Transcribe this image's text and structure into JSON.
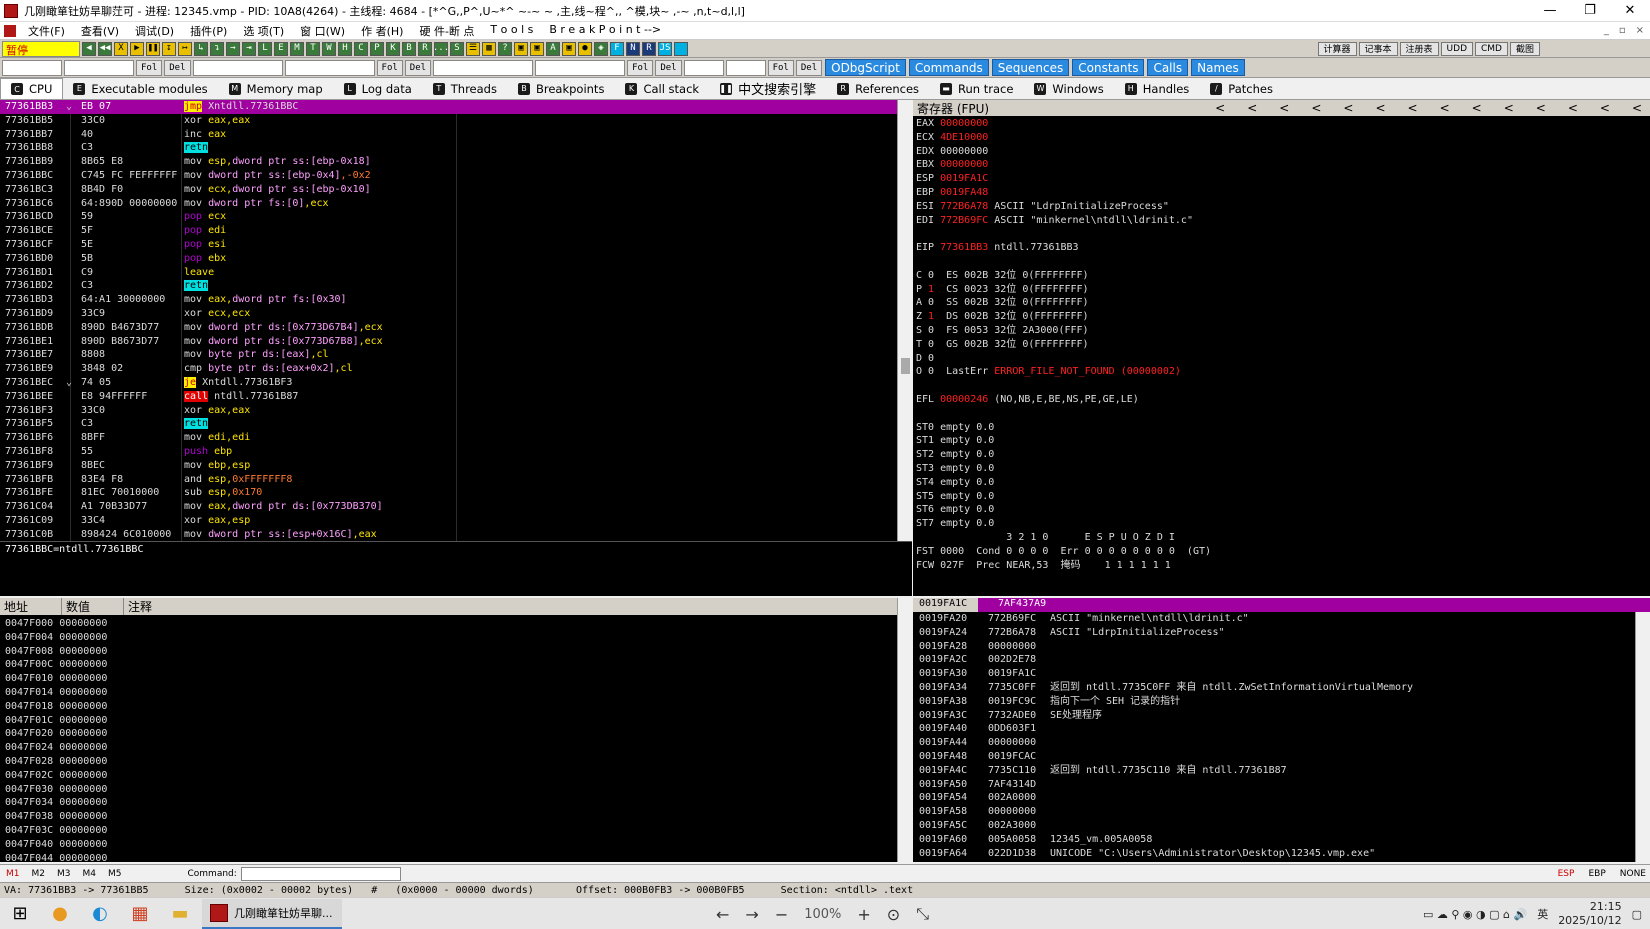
{
  "title": "几刚瞰箪钍妨旱聊茳可 - 进程: 12345.vmp - PID: 10A8(4264) - 主线程: 4684 - [*^G,,P^,U~*^ ~-~ ~ ,主,线~程^,, ^模,块~ ,-~ ,n,t~d,l,l]",
  "window_controls": [
    "—",
    "❐",
    "✕"
  ],
  "menu": [
    "文件(F)",
    "查看(V)",
    "调试(D)",
    "插件(P)",
    "选 项(T)",
    "窗 口(W)",
    "作 者(H)",
    "硬 件-断 点",
    "T o o l s",
    "B r e a k P o i n t -->"
  ],
  "menu_right": [
    "_",
    "▫",
    "×"
  ],
  "status_pause": "暂停",
  "toolbar_icons": [
    {
      "g": "◀",
      "k": "g"
    },
    {
      "g": "◀◀",
      "k": "g"
    },
    {
      "g": "X",
      "k": "y"
    },
    {
      "g": "▶",
      "k": "y"
    },
    {
      "g": "❚❚",
      "k": "y"
    },
    {
      "g": "↧",
      "k": "y"
    },
    {
      "g": "↦",
      "k": "y"
    },
    {
      "g": "↳",
      "k": "g"
    },
    {
      "g": "↴",
      "k": "g"
    },
    {
      "g": "→",
      "k": "g"
    },
    {
      "g": "⇥",
      "k": "g"
    },
    {
      "g": "L",
      "k": "g"
    },
    {
      "g": "E",
      "k": "g"
    },
    {
      "g": "M",
      "k": "g"
    },
    {
      "g": "T",
      "k": "g"
    },
    {
      "g": "W",
      "k": "g"
    },
    {
      "g": "H",
      "k": "g"
    },
    {
      "g": "C",
      "k": "g"
    },
    {
      "g": "P",
      "k": "g"
    },
    {
      "g": "K",
      "k": "g"
    },
    {
      "g": "B",
      "k": "g"
    },
    {
      "g": "R",
      "k": "g"
    },
    {
      "g": "...",
      "k": "g"
    },
    {
      "g": "S",
      "k": "g"
    },
    {
      "g": "☰",
      "k": "y"
    },
    {
      "g": "▦",
      "k": "y"
    },
    {
      "g": "?",
      "k": "g"
    },
    {
      "g": "▣",
      "k": "y"
    },
    {
      "g": "▣",
      "k": "y"
    },
    {
      "g": "A",
      "k": "g"
    },
    {
      "g": "▣",
      "k": "y"
    },
    {
      "g": "●",
      "k": "y"
    },
    {
      "g": "◈",
      "k": "g"
    },
    {
      "g": "F",
      "k": "c"
    },
    {
      "g": "N",
      "k": "b"
    },
    {
      "g": "R",
      "k": "b"
    },
    {
      "g": "JS",
      "k": "c"
    },
    {
      "g": " ",
      "k": "c"
    }
  ],
  "toolbar_tools": [
    "计算器",
    "记事本",
    "注册表",
    "UDD",
    "CMD",
    "截图"
  ],
  "fol_del_groups": [
    [
      "Fol",
      "Del"
    ],
    [
      "Fol",
      "Del"
    ],
    [
      "Fol",
      "Del"
    ],
    [
      "Fol",
      "Del"
    ]
  ],
  "plugin_buttons": [
    "ODbgScript",
    "Commands",
    "Sequences",
    "Constants",
    "Calls",
    "Names"
  ],
  "tabs": [
    {
      "label": "CPU",
      "icon": "C",
      "active": true
    },
    {
      "label": "Executable modules",
      "icon": "E"
    },
    {
      "label": "Memory map",
      "icon": "M"
    },
    {
      "label": "Log data",
      "icon": "L"
    },
    {
      "label": "Threads",
      "icon": "T"
    },
    {
      "label": "Breakpoints",
      "icon": "B"
    },
    {
      "label": "Call stack",
      "icon": "K"
    },
    {
      "label": "中文搜索引擎",
      "icon": "❚❚",
      "cn": true
    },
    {
      "label": "References",
      "icon": "R"
    },
    {
      "label": "Run trace",
      "icon": "▬"
    },
    {
      "label": "Windows",
      "icon": "W"
    },
    {
      "label": "Handles",
      "icon": "H"
    },
    {
      "label": "Patches",
      "icon": "/"
    }
  ],
  "disasm": [
    {
      "addr": "77361BB3",
      "mark": "⌄",
      "hex": "EB 07",
      "asm": [
        {
          "t": "jmp",
          "c": "kw-jmp"
        },
        {
          "t": " Xntdll.77361BBC"
        }
      ],
      "sel": true
    },
    {
      "addr": "77361BB5",
      "hex": "33C0",
      "asm": [
        {
          "t": "xor "
        },
        {
          "t": "eax,eax",
          "c": "arg-reg"
        }
      ]
    },
    {
      "addr": "77361BB7",
      "hex": "40",
      "asm": [
        {
          "t": "inc "
        },
        {
          "t": "eax",
          "c": "arg-reg"
        }
      ]
    },
    {
      "addr": "77361BB8",
      "hex": "C3",
      "asm": [
        {
          "t": "retn",
          "c": "kw-ret"
        }
      ]
    },
    {
      "addr": "77361BB9",
      "hex": "8B65 E8",
      "asm": [
        {
          "t": "mov "
        },
        {
          "t": "esp,",
          "c": "arg-reg"
        },
        {
          "t": "dword ptr ss:[ebp-0x18]",
          "c": "arg-mem"
        }
      ]
    },
    {
      "addr": "77361BBC",
      "hex": "C745 FC FEFFFFFF",
      "asm": [
        {
          "t": "mov "
        },
        {
          "t": "dword ptr ss:[ebp-0x4]",
          "c": "arg-mem"
        },
        {
          "t": ",-0x2",
          "c": "arg-num"
        }
      ]
    },
    {
      "addr": "77361BC3",
      "hex": "8B4D F0",
      "asm": [
        {
          "t": "mov "
        },
        {
          "t": "ecx,",
          "c": "arg-reg"
        },
        {
          "t": "dword ptr ss:[ebp-0x10]",
          "c": "arg-mem"
        }
      ]
    },
    {
      "addr": "77361BC6",
      "hex": "64:890D 00000000",
      "asm": [
        {
          "t": "mov "
        },
        {
          "t": "dword ptr fs:[0]",
          "c": "arg-mem"
        },
        {
          "t": ",ecx",
          "c": "arg-reg"
        }
      ]
    },
    {
      "addr": "77361BCD",
      "hex": "59",
      "asm": [
        {
          "t": "pop",
          "c": "kw-pop"
        },
        {
          "t": " ecx",
          "c": "arg-reg"
        }
      ]
    },
    {
      "addr": "77361BCE",
      "hex": "5F",
      "asm": [
        {
          "t": "pop",
          "c": "kw-pop"
        },
        {
          "t": " edi",
          "c": "arg-reg"
        }
      ]
    },
    {
      "addr": "77361BCF",
      "hex": "5E",
      "asm": [
        {
          "t": "pop",
          "c": "kw-pop"
        },
        {
          "t": " esi",
          "c": "arg-reg"
        }
      ]
    },
    {
      "addr": "77361BD0",
      "hex": "5B",
      "asm": [
        {
          "t": "pop",
          "c": "kw-pop"
        },
        {
          "t": " ebx",
          "c": "arg-reg"
        }
      ]
    },
    {
      "addr": "77361BD1",
      "hex": "C9",
      "asm": [
        {
          "t": "leave",
          "c": "arg-reg"
        }
      ]
    },
    {
      "addr": "77361BD2",
      "hex": "C3",
      "asm": [
        {
          "t": "retn",
          "c": "kw-ret"
        }
      ]
    },
    {
      "addr": "77361BD3",
      "hex": "64:A1 30000000",
      "asm": [
        {
          "t": "mov "
        },
        {
          "t": "eax,",
          "c": "arg-reg"
        },
        {
          "t": "dword ptr fs:[0x30]",
          "c": "arg-mem"
        }
      ]
    },
    {
      "addr": "77361BD9",
      "hex": "33C9",
      "asm": [
        {
          "t": "xor "
        },
        {
          "t": "ecx,ecx",
          "c": "arg-reg"
        }
      ]
    },
    {
      "addr": "77361BDB",
      "hex": "890D B4673D77",
      "asm": [
        {
          "t": "mov "
        },
        {
          "t": "dword ptr ds:[0x773D67B4]",
          "c": "arg-mem"
        },
        {
          "t": ",ecx",
          "c": "arg-reg"
        }
      ]
    },
    {
      "addr": "77361BE1",
      "hex": "890D B8673D77",
      "asm": [
        {
          "t": "mov "
        },
        {
          "t": "dword ptr ds:[0x773D67B8]",
          "c": "arg-mem"
        },
        {
          "t": ",ecx",
          "c": "arg-reg"
        }
      ]
    },
    {
      "addr": "77361BE7",
      "hex": "8808",
      "asm": [
        {
          "t": "mov "
        },
        {
          "t": "byte ptr ds:[eax]",
          "c": "arg-mem"
        },
        {
          "t": ",cl",
          "c": "arg-reg"
        }
      ]
    },
    {
      "addr": "77361BE9",
      "hex": "3848 02",
      "asm": [
        {
          "t": "cmp "
        },
        {
          "t": "byte ptr ds:[eax+0x2]",
          "c": "arg-mem"
        },
        {
          "t": ",cl",
          "c": "arg-reg"
        }
      ]
    },
    {
      "addr": "77361BEC",
      "mark": "⌄",
      "hex": "74 05",
      "asm": [
        {
          "t": "je",
          "c": "kw-jmp"
        },
        {
          "t": " Xntdll.77361BF3"
        }
      ]
    },
    {
      "addr": "77361BEE",
      "hex": "E8 94FFFFFF",
      "asm": [
        {
          "t": "call",
          "c": "kw-call"
        },
        {
          "t": " ntdll.77361B87"
        }
      ]
    },
    {
      "addr": "77361BF3",
      "hex": "33C0",
      "asm": [
        {
          "t": "xor "
        },
        {
          "t": "eax,eax",
          "c": "arg-reg"
        }
      ]
    },
    {
      "addr": "77361BF5",
      "hex": "C3",
      "asm": [
        {
          "t": "retn",
          "c": "kw-ret"
        }
      ]
    },
    {
      "addr": "77361BF6",
      "hex": "8BFF",
      "asm": [
        {
          "t": "mov "
        },
        {
          "t": "edi,edi",
          "c": "arg-reg"
        }
      ]
    },
    {
      "addr": "77361BF8",
      "hex": "55",
      "asm": [
        {
          "t": "push",
          "c": "kw-push"
        },
        {
          "t": " ebp",
          "c": "arg-reg"
        }
      ]
    },
    {
      "addr": "77361BF9",
      "hex": "8BEC",
      "asm": [
        {
          "t": "mov "
        },
        {
          "t": "ebp,esp",
          "c": "arg-reg"
        }
      ]
    },
    {
      "addr": "77361BFB",
      "hex": "83E4 F8",
      "asm": [
        {
          "t": "and "
        },
        {
          "t": "esp,",
          "c": "arg-reg"
        },
        {
          "t": "0xFFFFFFF8",
          "c": "arg-num"
        }
      ]
    },
    {
      "addr": "77361BFE",
      "hex": "81EC 70010000",
      "asm": [
        {
          "t": "sub "
        },
        {
          "t": "esp,",
          "c": "arg-reg"
        },
        {
          "t": "0x170",
          "c": "arg-num"
        }
      ]
    },
    {
      "addr": "77361C04",
      "hex": "A1 70B33D77",
      "asm": [
        {
          "t": "mov "
        },
        {
          "t": "eax,",
          "c": "arg-reg"
        },
        {
          "t": "dword ptr ds:[0x773DB370]",
          "c": "arg-mem"
        }
      ]
    },
    {
      "addr": "77361C09",
      "hex": "33C4",
      "asm": [
        {
          "t": "xor "
        },
        {
          "t": "eax,esp",
          "c": "arg-reg"
        }
      ]
    },
    {
      "addr": "77361C0B",
      "hex": "898424 6C010000",
      "asm": [
        {
          "t": "mov "
        },
        {
          "t": "dword ptr ss:[esp+0x16C]",
          "c": "arg-mem"
        },
        {
          "t": ",eax",
          "c": "arg-reg"
        }
      ]
    }
  ],
  "info_text": "77361BBC=ntdll.77361BBC",
  "reg_header": "寄存器 (FPU)",
  "reg_arrows": [
    "<",
    "<",
    "<",
    "<",
    "<",
    "<",
    "<",
    "<",
    "<",
    "<",
    "<",
    "<",
    "<",
    "<"
  ],
  "registers": [
    [
      {
        "t": "EAX "
      },
      {
        "t": "00000000",
        "c": "red"
      }
    ],
    [
      {
        "t": "ECX "
      },
      {
        "t": "4DE10000",
        "c": "red"
      }
    ],
    [
      {
        "t": "EDX 00000000"
      }
    ],
    [
      {
        "t": "EBX "
      },
      {
        "t": "00000000",
        "c": "red"
      }
    ],
    [
      {
        "t": "ESP "
      },
      {
        "t": "0019FA1C",
        "c": "red"
      }
    ],
    [
      {
        "t": "EBP "
      },
      {
        "t": "0019FA48",
        "c": "red"
      }
    ],
    [
      {
        "t": "ESI "
      },
      {
        "t": "772B6A78",
        "c": "red"
      },
      {
        "t": " ASCII \"LdrpInitializeProcess\""
      }
    ],
    [
      {
        "t": "EDI "
      },
      {
        "t": "772B69FC",
        "c": "red"
      },
      {
        "t": " ASCII \"minkernel\\ntdll\\ldrinit.c\""
      }
    ],
    [
      {
        "t": ""
      }
    ],
    [
      {
        "t": "EIP "
      },
      {
        "t": "77361BB3",
        "c": "red"
      },
      {
        "t": " ntdll.77361BB3"
      }
    ],
    [
      {
        "t": ""
      }
    ],
    [
      {
        "t": "C 0  ES 002B 32位 0(FFFFFFFF)"
      }
    ],
    [
      {
        "t": "P "
      },
      {
        "t": "1",
        "c": "red"
      },
      {
        "t": "  CS 0023 32位 0(FFFFFFFF)"
      }
    ],
    [
      {
        "t": "A 0  SS 002B 32位 0(FFFFFFFF)"
      }
    ],
    [
      {
        "t": "Z "
      },
      {
        "t": "1",
        "c": "red"
      },
      {
        "t": "  DS 002B 32位 0(FFFFFFFF)"
      }
    ],
    [
      {
        "t": "S 0  FS 0053 32位 2A3000(FFF)"
      }
    ],
    [
      {
        "t": "T 0  GS 002B 32位 0(FFFFFFFF)"
      }
    ],
    [
      {
        "t": "D 0"
      }
    ],
    [
      {
        "t": "O 0  LastErr "
      },
      {
        "t": "ERROR_FILE_NOT_FOUND (00000002)",
        "c": "red"
      }
    ],
    [
      {
        "t": ""
      }
    ],
    [
      {
        "t": "EFL "
      },
      {
        "t": "00000246",
        "c": "red"
      },
      {
        "t": " (NO,NB,E,BE,NS,PE,GE,LE)"
      }
    ],
    [
      {
        "t": ""
      }
    ],
    [
      {
        "t": "ST0 empty 0.0"
      }
    ],
    [
      {
        "t": "ST1 empty 0.0"
      }
    ],
    [
      {
        "t": "ST2 empty 0.0"
      }
    ],
    [
      {
        "t": "ST3 empty 0.0"
      }
    ],
    [
      {
        "t": "ST4 empty 0.0"
      }
    ],
    [
      {
        "t": "ST5 empty 0.0"
      }
    ],
    [
      {
        "t": "ST6 empty 0.0"
      }
    ],
    [
      {
        "t": "ST7 empty 0.0"
      }
    ],
    [
      {
        "t": "               3 2 1 0      E S P U O Z D I"
      }
    ],
    [
      {
        "t": "FST 0000  Cond 0 0 0 0  Err 0 0 0 0 0 0 0 0  (GT)"
      }
    ],
    [
      {
        "t": "FCW 027F  Prec NEAR,53  掩码    1 1 1 1 1 1"
      }
    ]
  ],
  "dump_headers": [
    "地址",
    "数值",
    "注释"
  ],
  "dump_rows": [
    [
      "0047F000",
      "00000000"
    ],
    [
      "0047F004",
      "00000000"
    ],
    [
      "0047F008",
      "00000000"
    ],
    [
      "0047F00C",
      "00000000"
    ],
    [
      "0047F010",
      "00000000"
    ],
    [
      "0047F014",
      "00000000"
    ],
    [
      "0047F018",
      "00000000"
    ],
    [
      "0047F01C",
      "00000000"
    ],
    [
      "0047F020",
      "00000000"
    ],
    [
      "0047F024",
      "00000000"
    ],
    [
      "0047F028",
      "00000000"
    ],
    [
      "0047F02C",
      "00000000"
    ],
    [
      "0047F030",
      "00000000"
    ],
    [
      "0047F034",
      "00000000"
    ],
    [
      "0047F038",
      "00000000"
    ],
    [
      "0047F03C",
      "00000000"
    ],
    [
      "0047F040",
      "00000000"
    ],
    [
      "0047F044",
      "00000000"
    ]
  ],
  "stack_header": {
    "addr": "0019FA1C",
    "val": "7AF437A9"
  },
  "stack_rows": [
    [
      "0019FA20",
      "772B69FC",
      "ASCII \"minkernel\\ntdll\\ldrinit.c\""
    ],
    [
      "0019FA24",
      "772B6A78",
      "ASCII \"LdrpInitializeProcess\""
    ],
    [
      "0019FA28",
      "00000000",
      ""
    ],
    [
      "0019FA2C",
      "002D2E78",
      ""
    ],
    [
      "0019FA30",
      "0019FA1C",
      ""
    ],
    [
      "0019FA34",
      "7735C0FF",
      "返回到 ntdll.7735C0FF 来自 ntdll.ZwSetInformationVirtualMemory"
    ],
    [
      "0019FA38",
      "0019FC9C",
      "指向下一个 SEH 记录的指针"
    ],
    [
      "0019FA3C",
      "7732ADE0",
      "SE处理程序"
    ],
    [
      "0019FA40",
      "0DD603F1",
      ""
    ],
    [
      "0019FA44",
      "00000000",
      ""
    ],
    [
      "0019FA48",
      "0019FCAC",
      ""
    ],
    [
      "0019FA4C",
      "7735C110",
      "返回到 ntdll.7735C110 来自 ntdll.77361B87"
    ],
    [
      "0019FA50",
      "7AF4314D",
      ""
    ],
    [
      "0019FA54",
      "002A0000",
      ""
    ],
    [
      "0019FA58",
      "00000000",
      ""
    ],
    [
      "0019FA5C",
      "002A3000",
      ""
    ],
    [
      "0019FA60",
      "005A0058",
      "12345_vm.005A0058"
    ],
    [
      "0019FA64",
      "022D1D38",
      "UNICODE \"C:\\Users\\Administrator\\Desktop\\12345.vmp.exe\""
    ]
  ],
  "cmd_marks": [
    "M1",
    "M2",
    "M3",
    "M4",
    "M5"
  ],
  "cmd_label": "Command:",
  "cmd_right": [
    "ESP",
    "EBP",
    "NONE"
  ],
  "statusbar": "VA: 77361BB3 -> 77361BB5      Size: (0x0002 - 00002 bytes)   #   (0x0000 - 00000 dwords)       Offset: 000B0FB3 -> 000B0FB5      Section: <ntdll> .text",
  "taskbar_app": "几刚瞰箪钍妨旱聊...",
  "zoom": "100%",
  "clock_time": "21:15",
  "clock_date": "2025/10/12",
  "ime": "英"
}
